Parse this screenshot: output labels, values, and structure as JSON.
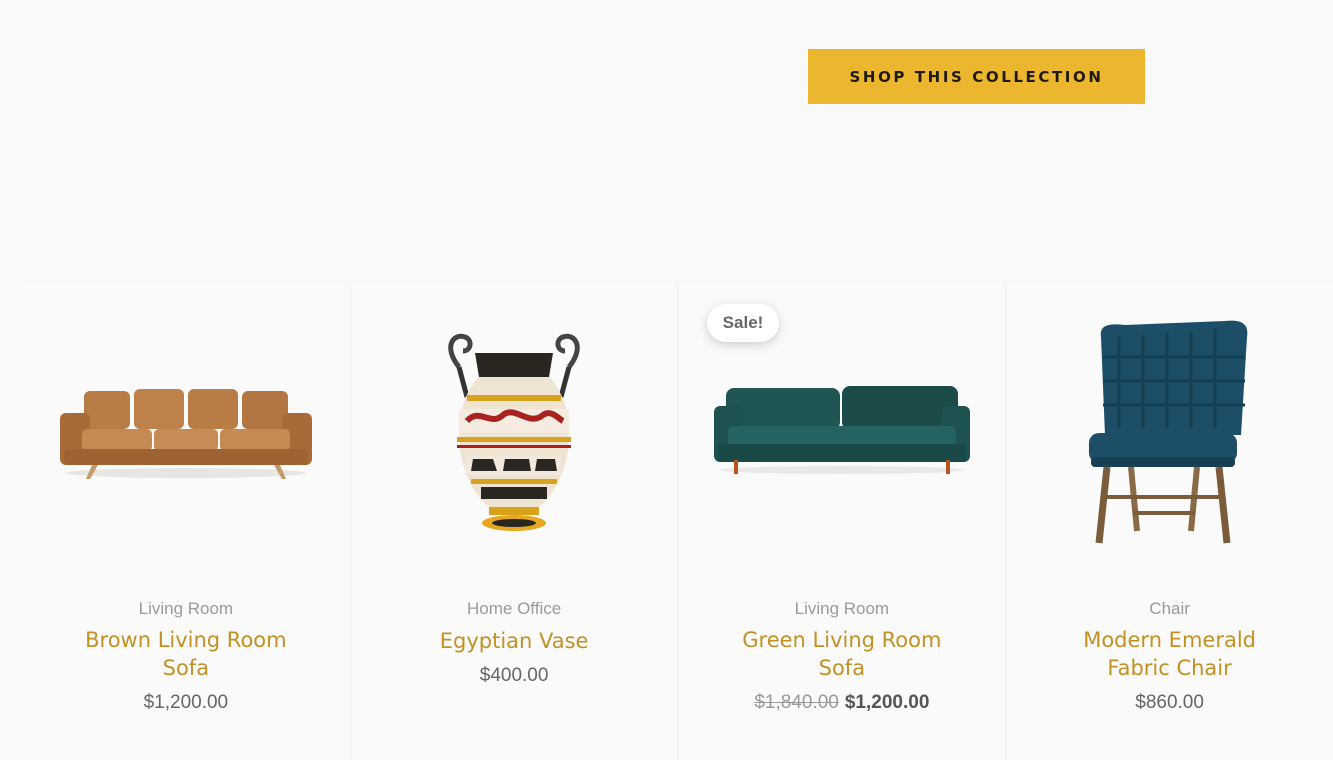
{
  "cta": {
    "label": "SHOP THIS COLLECTION",
    "color": "#ecb72f"
  },
  "accent_color": "#c39121",
  "sale_badge": "Sale!",
  "products": [
    {
      "category": "Living Room",
      "name": "Brown Living Room Sofa",
      "price": "$1,200.00",
      "image_icon": "brown-leather-sofa"
    },
    {
      "category": "Home Office",
      "name": "Egyptian Vase",
      "price": "$400.00",
      "image_icon": "greek-amphora-vase"
    },
    {
      "category": "Living Room",
      "name": "Green Living Room Sofa",
      "old_price": "$1,840.00",
      "price": "$1,200.00",
      "on_sale": true,
      "image_icon": "green-velvet-sofa"
    },
    {
      "category": "Chair",
      "name": "Modern Emerald Fabric Chair",
      "price": "$860.00",
      "image_icon": "emerald-fabric-chair"
    }
  ]
}
